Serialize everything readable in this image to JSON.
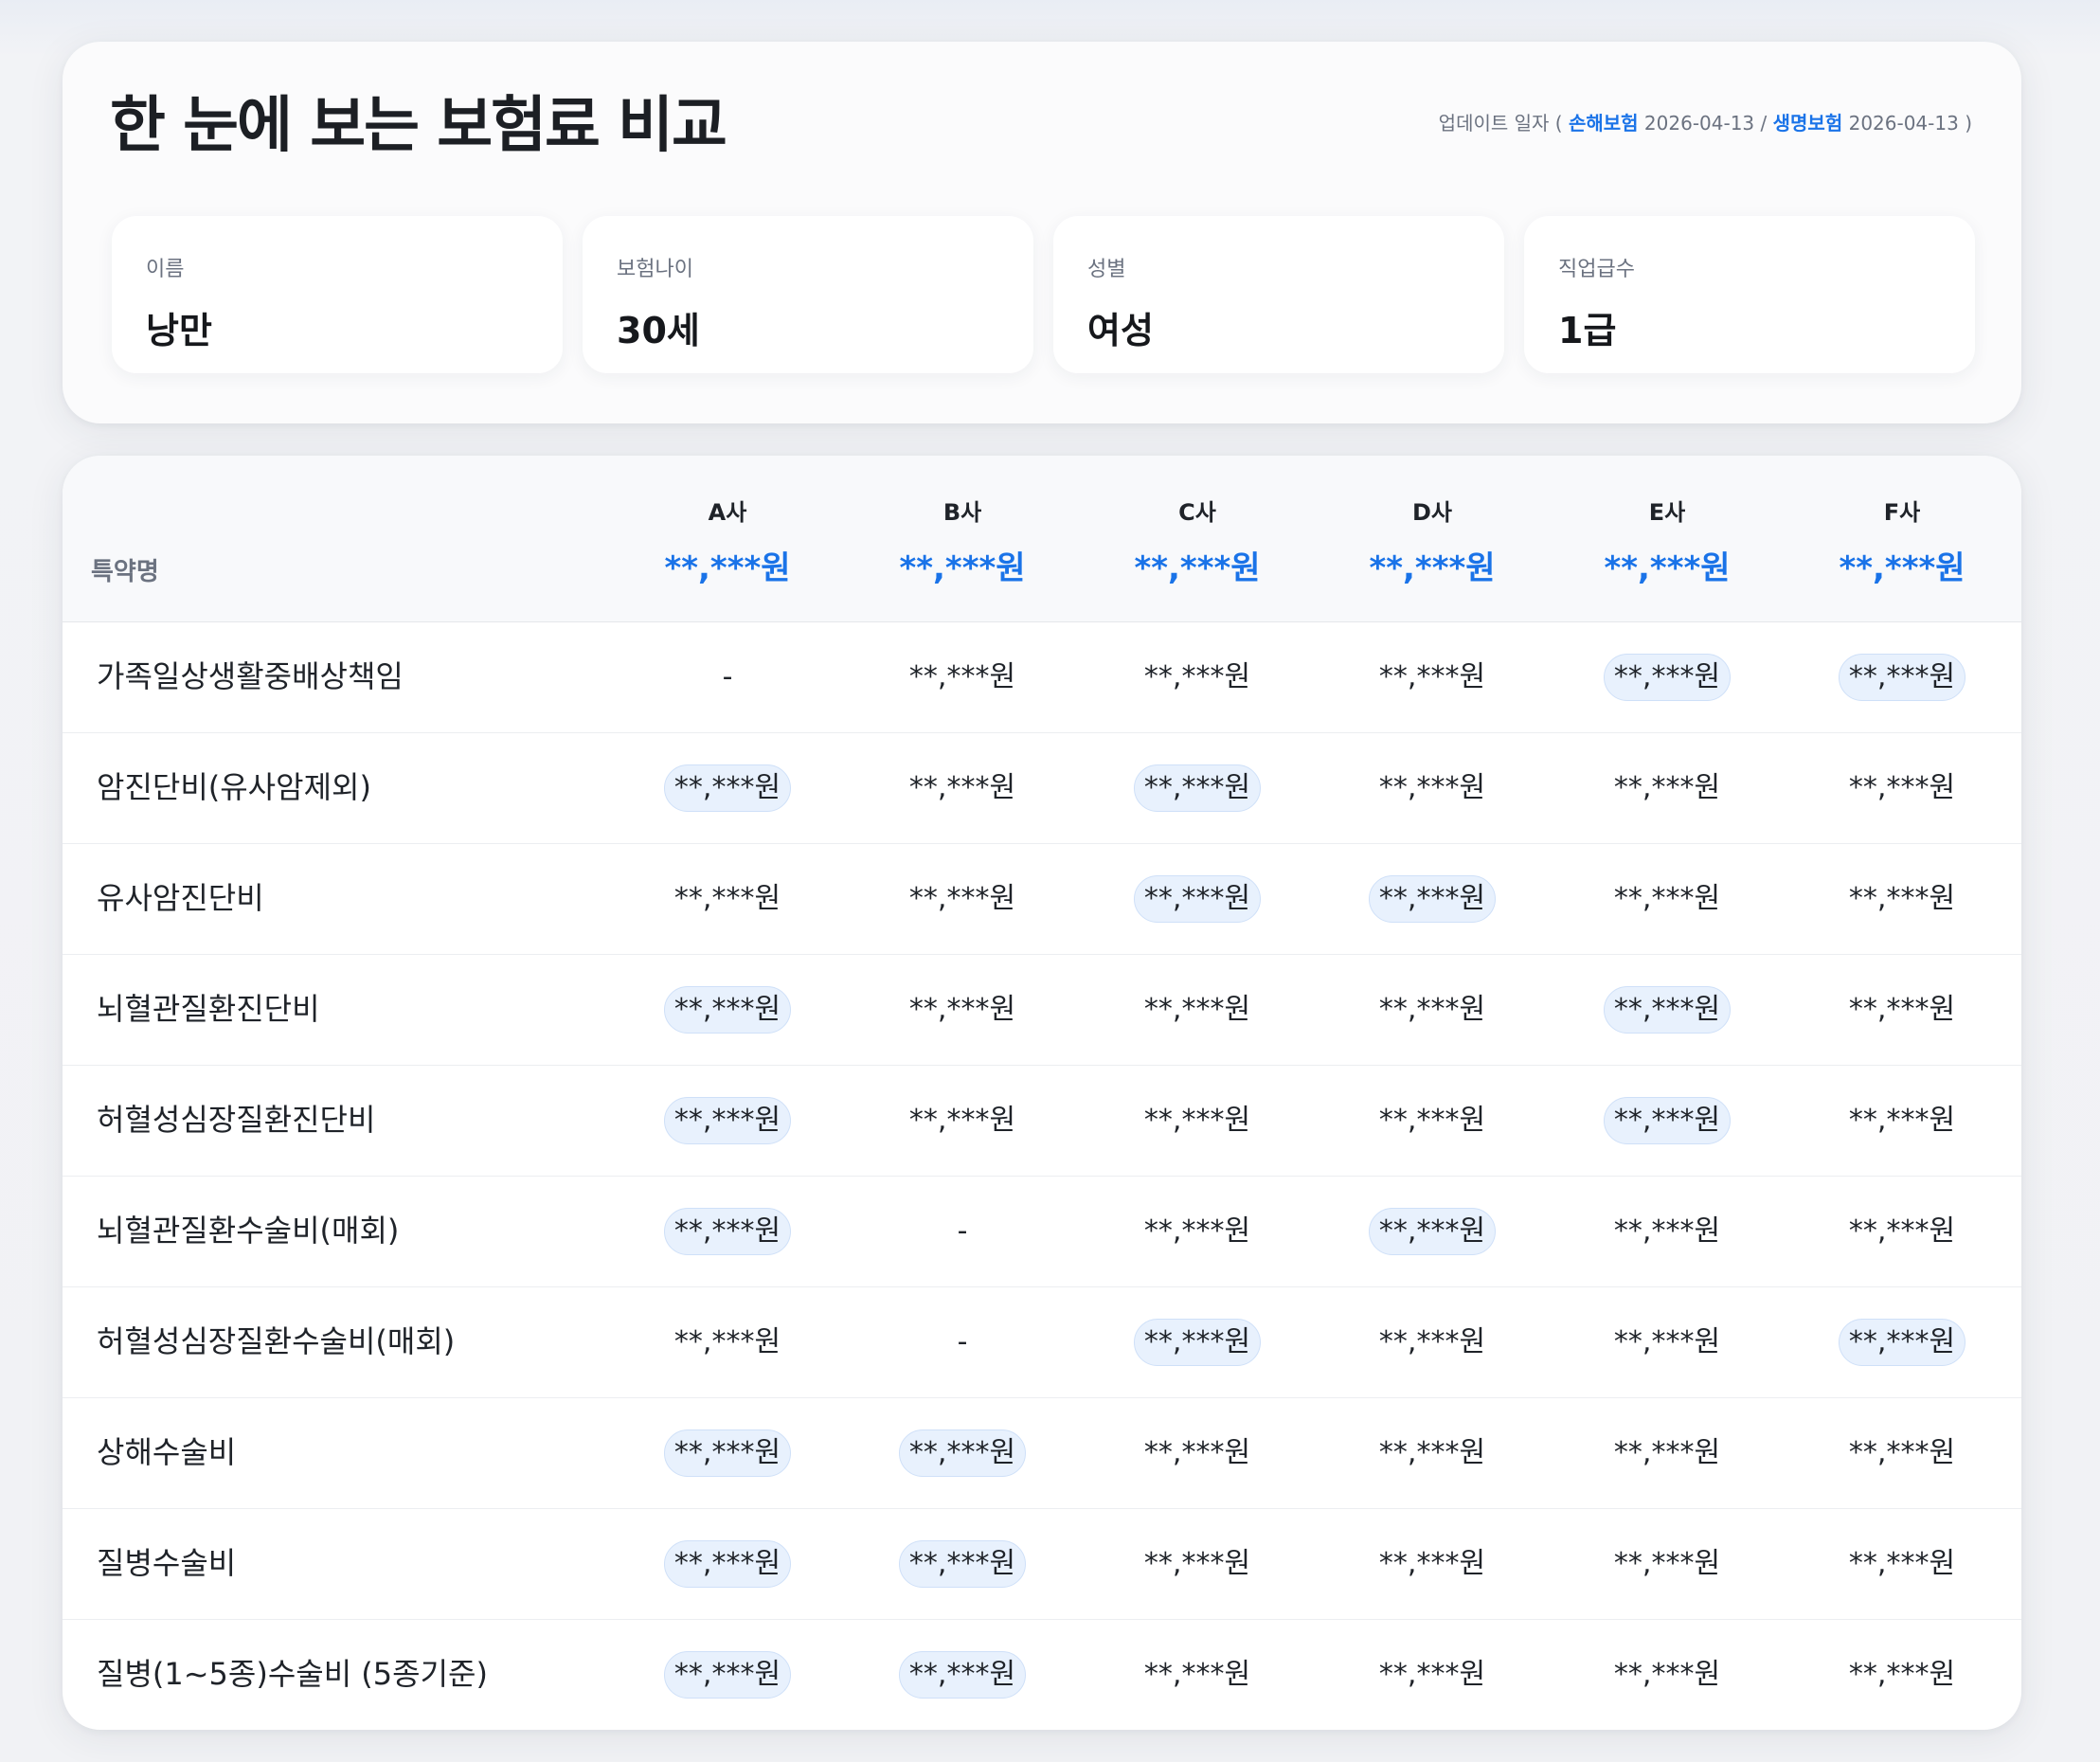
{
  "header": {
    "title": "한 눈에 보는 보험료 비교",
    "update_label": "업데이트 일자 (",
    "nonlife_label": "손해보험",
    "nonlife_date": "2026-04-13",
    "separator": "/",
    "life_label": "생명보험",
    "life_date": "2026-04-13",
    "close": ")"
  },
  "profile": [
    {
      "label": "이름",
      "value": "낭만"
    },
    {
      "label": "보험나이",
      "value": "30세"
    },
    {
      "label": "성별",
      "value": "여성"
    },
    {
      "label": "직업급수",
      "value": "1급"
    }
  ],
  "table": {
    "rider_header": "특약명",
    "companies": [
      {
        "name": "A사",
        "total": "**,***원"
      },
      {
        "name": "B사",
        "total": "**,***원"
      },
      {
        "name": "C사",
        "total": "**,***원"
      },
      {
        "name": "D사",
        "total": "**,***원"
      },
      {
        "name": "E사",
        "total": "**,***원"
      },
      {
        "name": "F사",
        "total": "**,***원"
      }
    ],
    "rows": [
      {
        "name": "가족일상생활중배상책임",
        "cells": [
          {
            "v": "-",
            "hl": false
          },
          {
            "v": "**,***원",
            "hl": false
          },
          {
            "v": "**,***원",
            "hl": false
          },
          {
            "v": "**,***원",
            "hl": false
          },
          {
            "v": "**,***원",
            "hl": true
          },
          {
            "v": "**,***원",
            "hl": true
          }
        ]
      },
      {
        "name": "암진단비(유사암제외)",
        "cells": [
          {
            "v": "**,***원",
            "hl": true
          },
          {
            "v": "**,***원",
            "hl": false
          },
          {
            "v": "**,***원",
            "hl": true
          },
          {
            "v": "**,***원",
            "hl": false
          },
          {
            "v": "**,***원",
            "hl": false
          },
          {
            "v": "**,***원",
            "hl": false
          }
        ]
      },
      {
        "name": "유사암진단비",
        "cells": [
          {
            "v": "**,***원",
            "hl": false
          },
          {
            "v": "**,***원",
            "hl": false
          },
          {
            "v": "**,***원",
            "hl": true
          },
          {
            "v": "**,***원",
            "hl": true
          },
          {
            "v": "**,***원",
            "hl": false
          },
          {
            "v": "**,***원",
            "hl": false
          }
        ]
      },
      {
        "name": "뇌혈관질환진단비",
        "cells": [
          {
            "v": "**,***원",
            "hl": true
          },
          {
            "v": "**,***원",
            "hl": false
          },
          {
            "v": "**,***원",
            "hl": false
          },
          {
            "v": "**,***원",
            "hl": false
          },
          {
            "v": "**,***원",
            "hl": true
          },
          {
            "v": "**,***원",
            "hl": false
          }
        ]
      },
      {
        "name": "허혈성심장질환진단비",
        "cells": [
          {
            "v": "**,***원",
            "hl": true
          },
          {
            "v": "**,***원",
            "hl": false
          },
          {
            "v": "**,***원",
            "hl": false
          },
          {
            "v": "**,***원",
            "hl": false
          },
          {
            "v": "**,***원",
            "hl": true
          },
          {
            "v": "**,***원",
            "hl": false
          }
        ]
      },
      {
        "name": "뇌혈관질환수술비(매회)",
        "cells": [
          {
            "v": "**,***원",
            "hl": true
          },
          {
            "v": "-",
            "hl": false
          },
          {
            "v": "**,***원",
            "hl": false
          },
          {
            "v": "**,***원",
            "hl": true
          },
          {
            "v": "**,***원",
            "hl": false
          },
          {
            "v": "**,***원",
            "hl": false
          }
        ]
      },
      {
        "name": "허혈성심장질환수술비(매회)",
        "cells": [
          {
            "v": "**,***원",
            "hl": false
          },
          {
            "v": "-",
            "hl": false
          },
          {
            "v": "**,***원",
            "hl": true
          },
          {
            "v": "**,***원",
            "hl": false
          },
          {
            "v": "**,***원",
            "hl": false
          },
          {
            "v": "**,***원",
            "hl": true
          }
        ]
      },
      {
        "name": "상해수술비",
        "cells": [
          {
            "v": "**,***원",
            "hl": true
          },
          {
            "v": "**,***원",
            "hl": true
          },
          {
            "v": "**,***원",
            "hl": false
          },
          {
            "v": "**,***원",
            "hl": false
          },
          {
            "v": "**,***원",
            "hl": false
          },
          {
            "v": "**,***원",
            "hl": false
          }
        ]
      },
      {
        "name": "질병수술비",
        "cells": [
          {
            "v": "**,***원",
            "hl": true
          },
          {
            "v": "**,***원",
            "hl": true
          },
          {
            "v": "**,***원",
            "hl": false
          },
          {
            "v": "**,***원",
            "hl": false
          },
          {
            "v": "**,***원",
            "hl": false
          },
          {
            "v": "**,***원",
            "hl": false
          }
        ]
      },
      {
        "name": "질병(1~5종)수술비 (5종기준)",
        "cells": [
          {
            "v": "**,***원",
            "hl": true
          },
          {
            "v": "**,***원",
            "hl": true
          },
          {
            "v": "**,***원",
            "hl": false
          },
          {
            "v": "**,***원",
            "hl": false
          },
          {
            "v": "**,***원",
            "hl": false
          },
          {
            "v": "**,***원",
            "hl": false
          }
        ]
      }
    ]
  },
  "colors": {
    "accent": "#1a73e8",
    "highlight_bg": "#e8f1fd"
  }
}
